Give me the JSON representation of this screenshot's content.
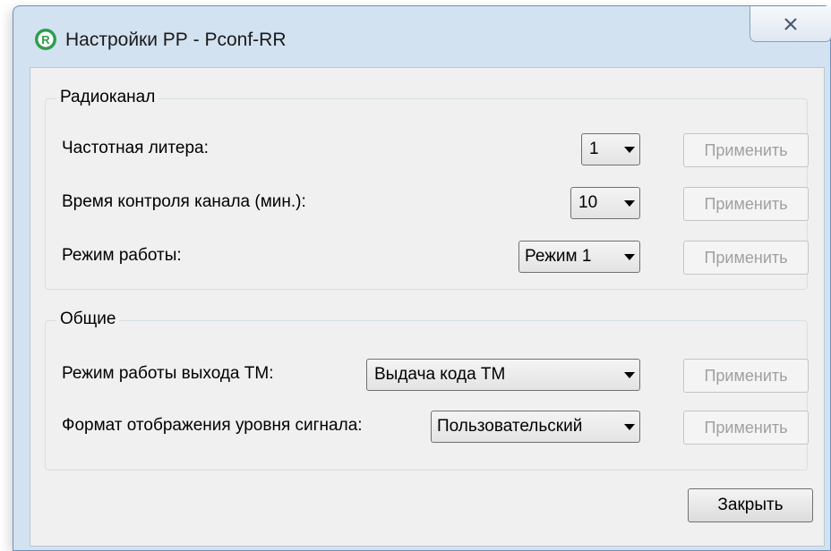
{
  "window": {
    "title": "Настройки РР - Pconf-RR"
  },
  "radio_group": {
    "caption": "Радиоканал",
    "rows": [
      {
        "label": "Частотная литера:",
        "value": "1",
        "apply": "Применить"
      },
      {
        "label": "Время контроля канала (мин.):",
        "value": "10",
        "apply": "Применить"
      },
      {
        "label": "Режим работы:",
        "value": "Режим 1",
        "apply": "Применить"
      }
    ]
  },
  "general_group": {
    "caption": "Общие",
    "rows": [
      {
        "label": "Режим работы выхода ТМ:",
        "value": "Выдача кода ТМ",
        "apply": "Применить"
      },
      {
        "label": "Формат отображения уровня сигнала:",
        "value": "Пользовательский",
        "apply": "Применить"
      }
    ]
  },
  "footer": {
    "close_label": "Закрыть"
  },
  "colors": {
    "frame": "#d3e2f1",
    "client": "#f0f0f0",
    "disabled_text": "#a0a0a0"
  }
}
